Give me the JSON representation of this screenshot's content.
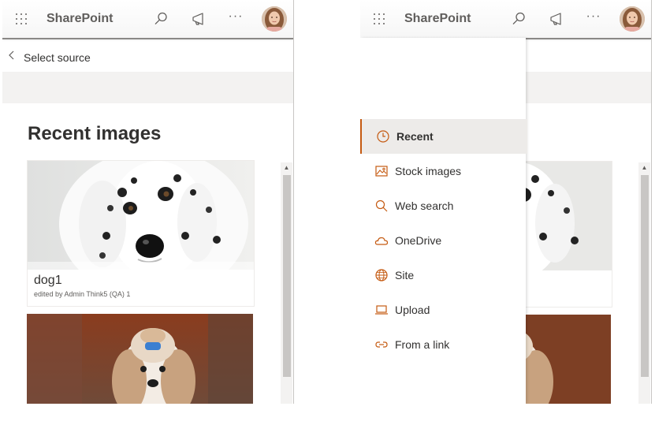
{
  "app": {
    "brand": "SharePoint",
    "accent_color": "#c55a11",
    "icons": [
      "waffle-icon",
      "search-icon",
      "megaphone-icon",
      "more-icon",
      "avatar"
    ]
  },
  "picker": {
    "back_label": "Select source",
    "section_title": "Recent images",
    "images": [
      {
        "title": "dog1",
        "subtitle": "edited by Admin Think5 (QA) 1"
      },
      {
        "title": "",
        "subtitle": ""
      }
    ]
  },
  "source_menu": {
    "items": [
      {
        "label": "Recent",
        "icon": "clock-icon",
        "selected": true
      },
      {
        "label": "Stock images",
        "icon": "image-icon",
        "selected": false
      },
      {
        "label": "Web search",
        "icon": "search-icon",
        "selected": false
      },
      {
        "label": "OneDrive",
        "icon": "cloud-icon",
        "selected": false
      },
      {
        "label": "Site",
        "icon": "globe-icon",
        "selected": false
      },
      {
        "label": "Upload",
        "icon": "laptop-icon",
        "selected": false
      },
      {
        "label": "From a link",
        "icon": "link-icon",
        "selected": false
      }
    ]
  }
}
